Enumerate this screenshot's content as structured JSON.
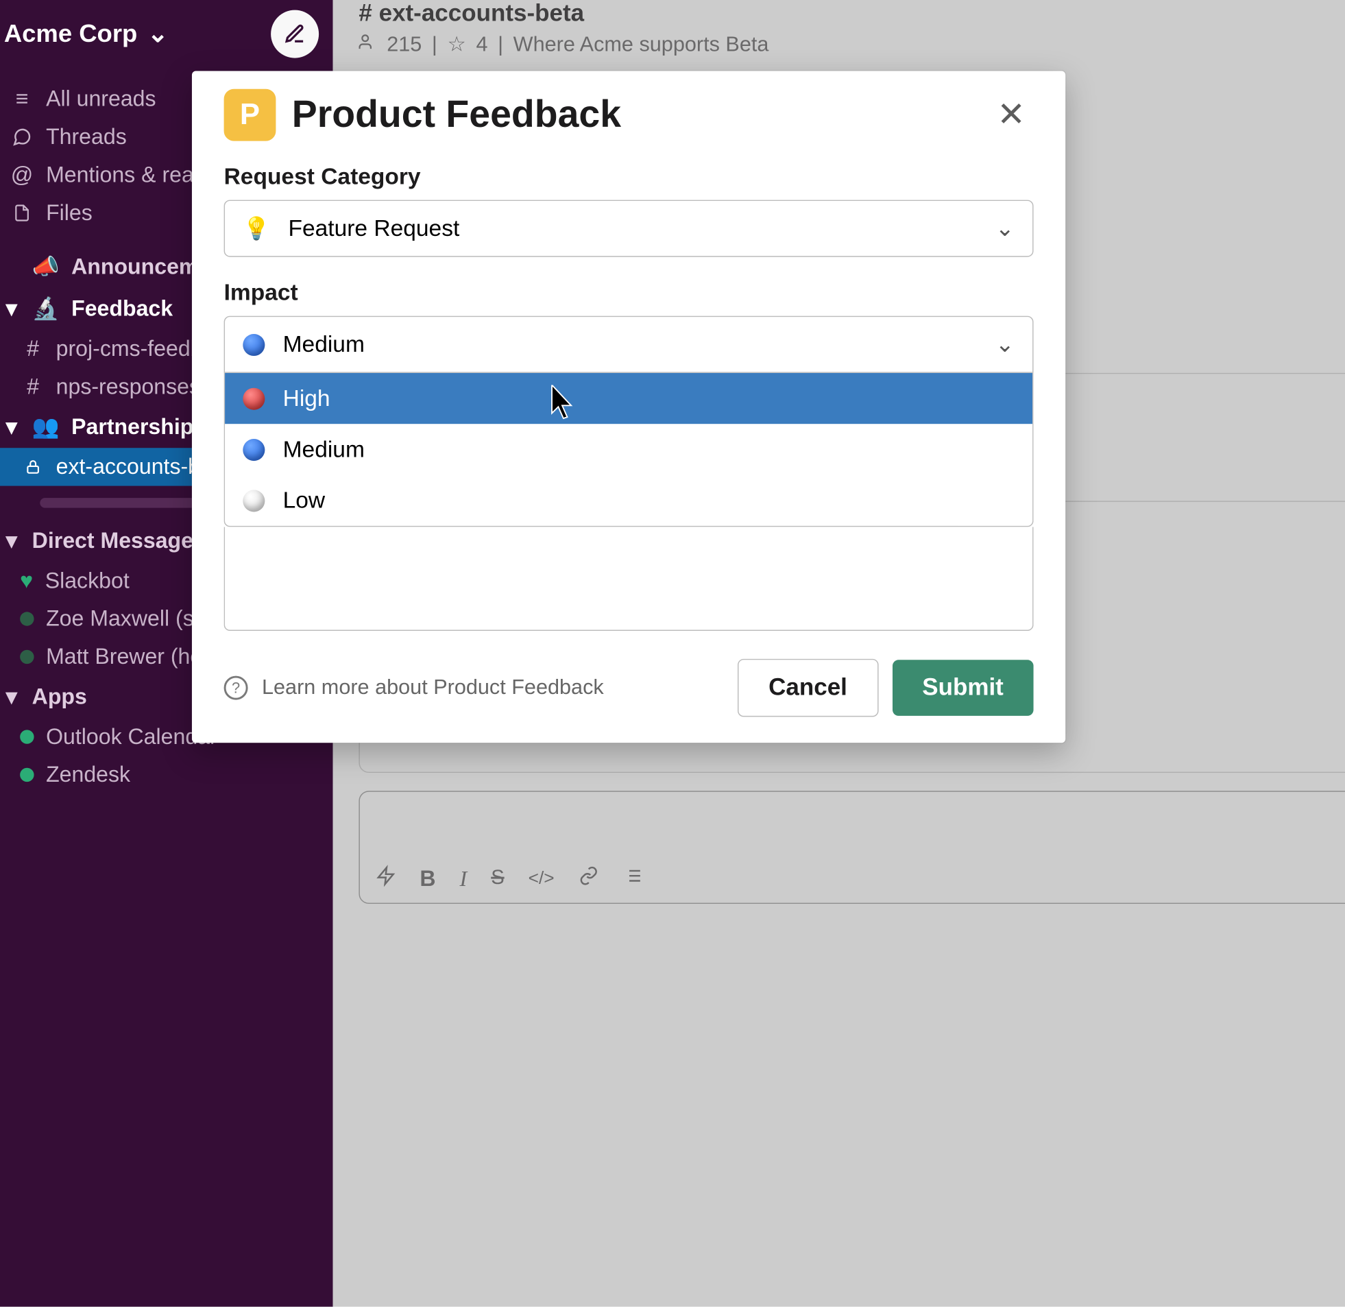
{
  "workspace": {
    "name": "Acme Corp"
  },
  "sidebar": {
    "nav": [
      {
        "label": "All unreads",
        "icon": "unreads"
      },
      {
        "label": "Threads",
        "icon": "threads"
      },
      {
        "label": "Mentions & reactions",
        "icon": "mentions"
      },
      {
        "label": "Files",
        "icon": "files"
      }
    ],
    "sections": [
      {
        "label": "Announcements",
        "emoji": "📣"
      },
      {
        "label": "Feedback",
        "emoji": "🔬",
        "bold": true,
        "channels": [
          {
            "prefix": "#",
            "label": "proj-cms-feedback"
          },
          {
            "prefix": "#",
            "label": "nps-responses"
          }
        ]
      },
      {
        "label": "Partnerships",
        "emoji": "👥",
        "bold": true,
        "channels": [
          {
            "prefix": "lock",
            "label": "ext-accounts-beta",
            "active": true
          }
        ]
      }
    ],
    "dms_header": "Direct Messages",
    "dms": [
      {
        "label": "Slackbot",
        "heart": true
      },
      {
        "label": "Zoe Maxwell (she/her)"
      },
      {
        "label": "Matt Brewer (he/him)"
      }
    ],
    "apps_header": "Apps",
    "apps": [
      {
        "label": "Outlook Calendar"
      },
      {
        "label": "Zendesk"
      }
    ]
  },
  "channel": {
    "name": "# ext-accounts-beta",
    "members": "215",
    "pins": "4",
    "topic": "Where Acme supports Beta"
  },
  "modal": {
    "badge": "P",
    "title": "Product Feedback",
    "fields": {
      "category": {
        "label": "Request Category",
        "value": "Feature Request",
        "emoji": "💡"
      },
      "impact": {
        "label": "Impact",
        "selected": "Medium",
        "options": [
          {
            "label": "High",
            "color": "red",
            "hover": true
          },
          {
            "label": "Medium",
            "color": "blue"
          },
          {
            "label": "Low",
            "color": "white"
          }
        ]
      }
    },
    "learn_more": "Learn more about Product Feedback",
    "cancel": "Cancel",
    "submit": "Submit"
  }
}
